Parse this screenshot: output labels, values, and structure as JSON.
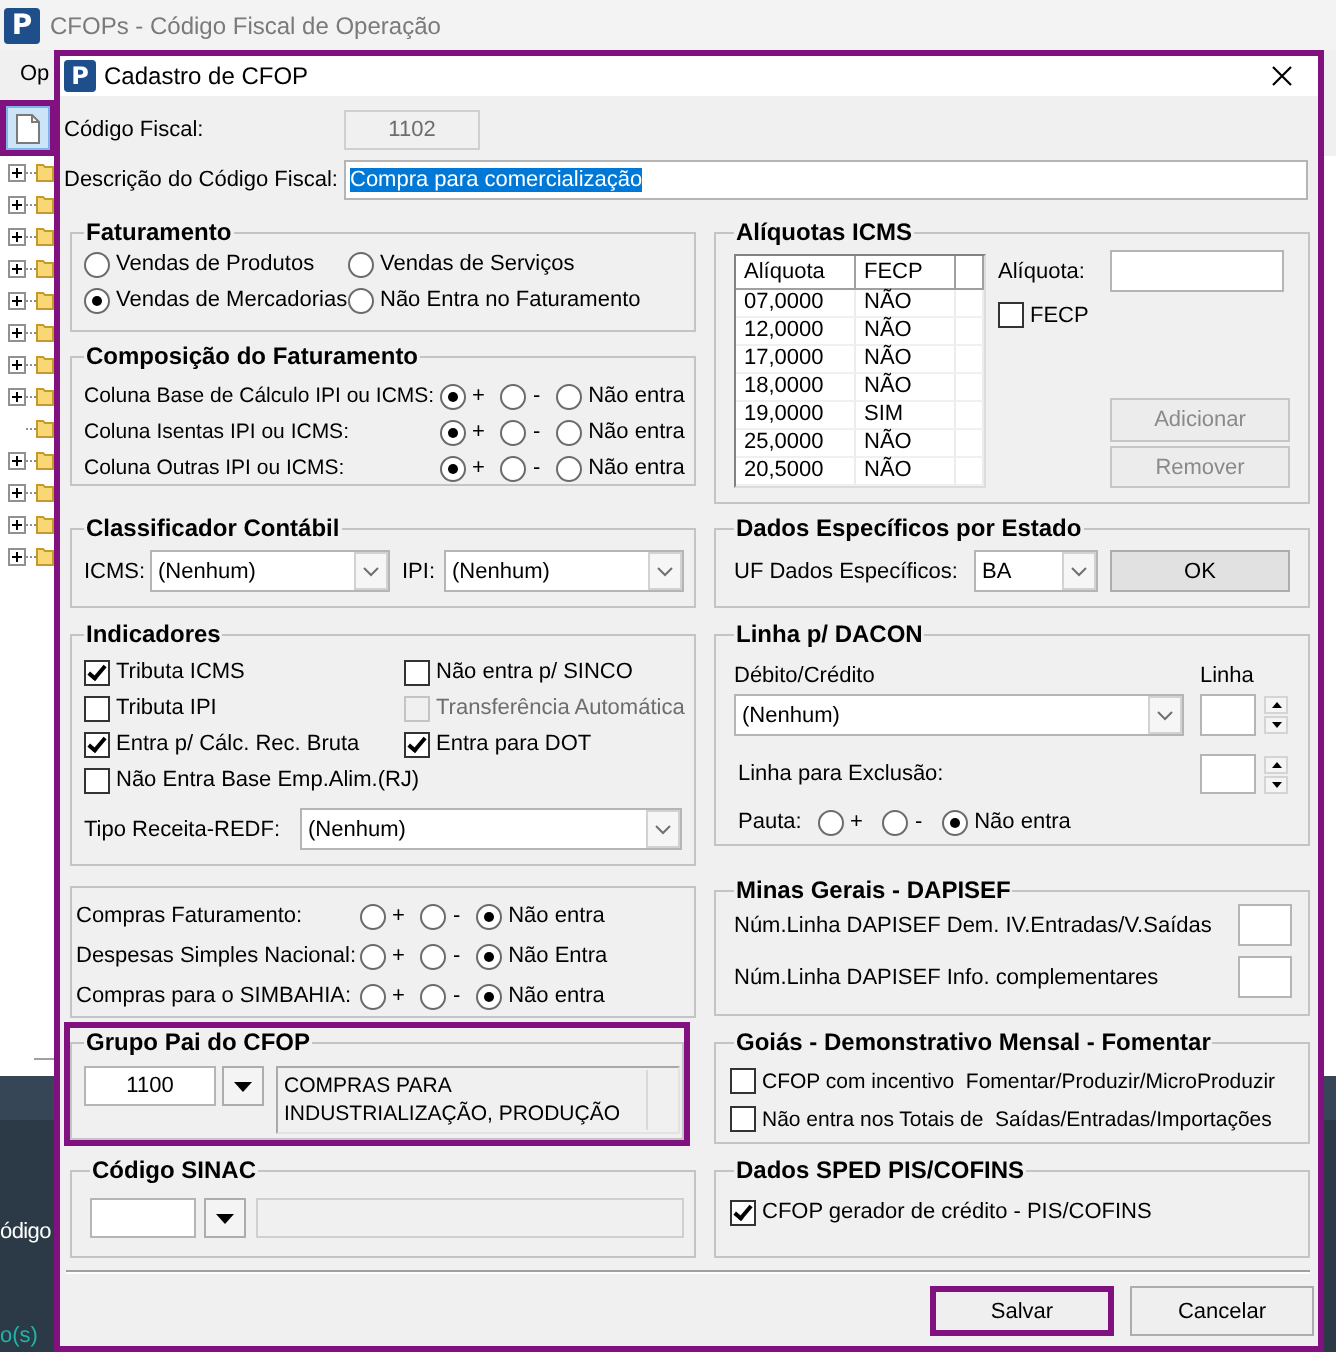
{
  "main_window": {
    "logo": "P",
    "title": "CFOPs - Código Fiscal de Operação",
    "menu": [
      {
        "label": "Op"
      }
    ],
    "toolbar": [
      {
        "kind": "document",
        "highlighted": true
      }
    ],
    "tree": [
      {
        "has_children": true
      },
      {
        "has_children": true
      },
      {
        "has_children": true
      },
      {
        "has_children": true
      },
      {
        "has_children": true
      },
      {
        "has_children": true
      },
      {
        "has_children": true
      },
      {
        "has_children": true
      },
      {
        "has_children": false
      },
      {
        "has_children": true
      },
      {
        "has_children": true
      },
      {
        "has_children": true
      },
      {
        "has_children": true
      }
    ],
    "side_panel": {
      "heading": "ódigo",
      "footer": "o(s)"
    }
  },
  "dialog": {
    "logo": "P",
    "title": "Cadastro de CFOP",
    "highlighted": true,
    "fields": [
      {
        "label": "Código Fiscal:",
        "value": "1102",
        "disabled": true,
        "text_selected": false
      },
      {
        "label": "Descrição do Código Fiscal:",
        "value": "Compra para comercialização",
        "disabled": false,
        "text_selected": true
      }
    ],
    "faturamento": {
      "title": "Faturamento",
      "options": [
        {
          "label": "Vendas de Produtos",
          "selected": false
        },
        {
          "label": "Vendas de Serviços",
          "selected": false
        },
        {
          "label": "Vendas de Mercadorias",
          "selected": true
        },
        {
          "label": "Não Entra no Faturamento",
          "selected": false
        }
      ]
    },
    "composicao": {
      "title": "Composição do Faturamento",
      "rows": [
        {
          "label": "Coluna Base de Cálculo IPI ou ICMS:",
          "options": [
            {
              "label": "+",
              "selected": true
            },
            {
              "label": "-",
              "selected": false
            },
            {
              "label": "Não entra",
              "selected": false
            }
          ]
        },
        {
          "label": "Coluna Isentas IPI ou ICMS:",
          "options": [
            {
              "label": "+",
              "selected": true
            },
            {
              "label": "-",
              "selected": false
            },
            {
              "label": "Não entra",
              "selected": false
            }
          ]
        },
        {
          "label": "Coluna Outras IPI ou ICMS:",
          "options": [
            {
              "label": "+",
              "selected": true
            },
            {
              "label": "-",
              "selected": false
            },
            {
              "label": "Não entra",
              "selected": false
            }
          ]
        }
      ]
    },
    "classificador": {
      "title": "Classificador Contábil",
      "selects": [
        {
          "label": "ICMS:",
          "value": "(Nenhum)"
        },
        {
          "label": "IPI:",
          "value": "(Nenhum)"
        }
      ]
    },
    "indicadores": {
      "title": "Indicadores",
      "checks": [
        {
          "label": "Tributa ICMS",
          "checked": true,
          "disabled": false
        },
        {
          "label": "Não entra p/ SINCO",
          "checked": false,
          "disabled": false
        },
        {
          "label": "Tributa IPI",
          "checked": false,
          "disabled": false
        },
        {
          "label": "Transferência Automática",
          "checked": false,
          "disabled": true
        },
        {
          "label": "Entra p/ Cálc. Rec. Bruta",
          "checked": true,
          "disabled": false
        },
        {
          "label": "Entra para DOT",
          "checked": true,
          "disabled": false
        },
        {
          "label": "Não Entra Base Emp.Alim.(RJ)",
          "checked": false,
          "disabled": false
        }
      ],
      "tipo_receita": {
        "label": "Tipo Receita-REDF:",
        "value": "(Nenhum)"
      }
    },
    "compras": {
      "rows": [
        {
          "label": "Compras Faturamento:",
          "options": [
            {
              "label": "+",
              "selected": false
            },
            {
              "label": "-",
              "selected": false
            },
            {
              "label": "Não entra",
              "selected": true
            }
          ]
        },
        {
          "label": "Despesas Simples Nacional:",
          "options": [
            {
              "label": "+",
              "selected": false
            },
            {
              "label": "-",
              "selected": false
            },
            {
              "label": "Não Entra",
              "selected": true
            }
          ]
        },
        {
          "label": "Compras para o SIMBAHIA:",
          "options": [
            {
              "label": "+",
              "selected": false
            },
            {
              "label": "-",
              "selected": false
            },
            {
              "label": "Não entra",
              "selected": true
            }
          ]
        }
      ]
    },
    "grupo_pai": {
      "title": "Grupo Pai do CFOP",
      "highlighted": true,
      "code": "1100",
      "description": [
        "COMPRAS PARA",
        "INDUSTRIALIZAÇÃO, PRODUÇÃO"
      ]
    },
    "codigo_sinac": {
      "title": "Código SINAC"
    },
    "aliquotas": {
      "title": "Alíquotas ICMS",
      "table": {
        "columns": [
          "Alíquota",
          "FECP"
        ],
        "rows": [
          [
            "07,0000",
            "NÃO"
          ],
          [
            "12,0000",
            "NÃO"
          ],
          [
            "17,0000",
            "NÃO"
          ],
          [
            "18,0000",
            "NÃO"
          ],
          [
            "19,0000",
            "SIM"
          ],
          [
            "25,0000",
            "NÃO"
          ],
          [
            "20,5000",
            "NÃO"
          ]
        ]
      },
      "aliquota_label": "Alíquota:",
      "fecp": {
        "label": "FECP",
        "checked": false
      },
      "buttons": [
        {
          "label": "Adicionar",
          "disabled": true
        },
        {
          "label": "Remover",
          "disabled": true
        }
      ]
    },
    "dados_estado": {
      "title": "Dados Específicos por Estado",
      "label": "UF Dados Específicos:",
      "value": "BA",
      "button": "OK"
    },
    "dacon": {
      "title": "Linha p/ DACON",
      "debito_label": "Débito/Crédito",
      "linha_label": "Linha",
      "debito_value": "(Nenhum)",
      "exclusao_label": "Linha para Exclusão:",
      "pauta": {
        "label": "Pauta:",
        "options": [
          {
            "label": "+",
            "selected": false
          },
          {
            "label": "-",
            "selected": false
          },
          {
            "label": "Não entra",
            "selected": true
          }
        ]
      }
    },
    "dapisef": {
      "title": "Minas Gerais - DAPISEF",
      "fields": [
        {
          "label": "Núm.Linha DAPISEF Dem. IV.Entradas/V.Saídas"
        },
        {
          "label": "Núm.Linha DAPISEF Info. complementares"
        }
      ]
    },
    "goias": {
      "title": "Goiás - Demonstrativo Mensal - Fomentar",
      "checks": [
        {
          "label": "CFOP com incentivo  Fomentar/Produzir/MicroProduzir",
          "checked": false
        },
        {
          "label": "Não entra nos Totais de  Saídas/Entradas/Importações",
          "checked": false
        }
      ]
    },
    "sped": {
      "title": "Dados SPED PIS/COFINS",
      "checks": [
        {
          "label": "CFOP gerador de crédito - PIS/COFINS",
          "checked": true
        }
      ]
    },
    "buttons": [
      {
        "label": "Salvar",
        "highlighted": true
      },
      {
        "label": "Cancelar",
        "highlighted": false
      }
    ]
  }
}
